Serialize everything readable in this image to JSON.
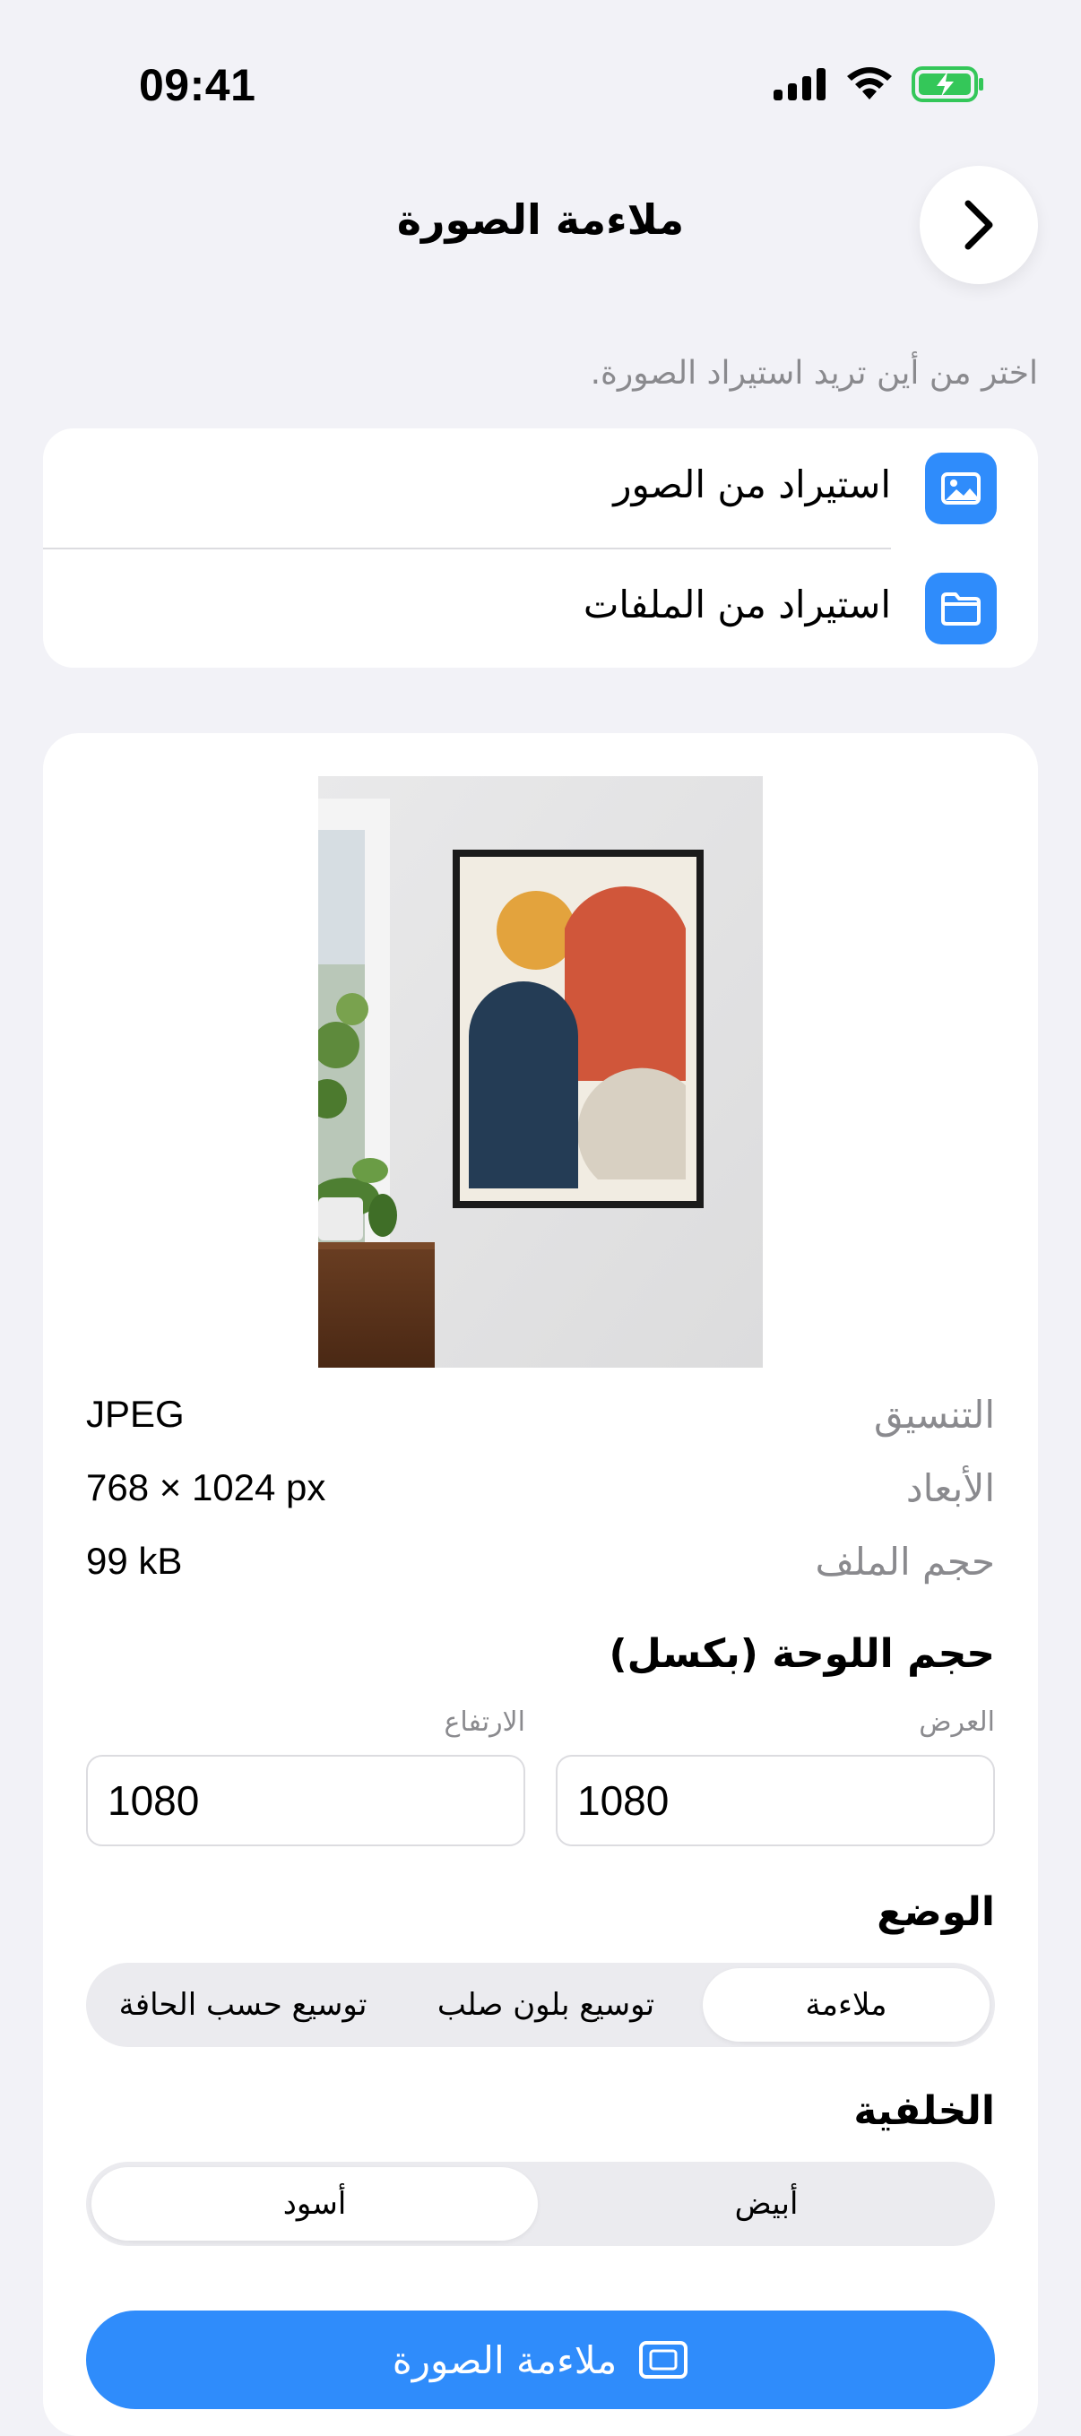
{
  "status_bar": {
    "time": "09:41"
  },
  "nav": {
    "title": "ملاءمة الصورة"
  },
  "hint": "اختر من أين تريد استيراد الصورة.",
  "import_options": [
    {
      "label": "استيراد من الصور",
      "icon": "photo-icon"
    },
    {
      "label": "استيراد من الملفات",
      "icon": "folder-icon"
    }
  ],
  "image_info": [
    {
      "key": "التنسيق",
      "value": "JPEG"
    },
    {
      "key": "الأبعاد",
      "value": "768 × 1024 px"
    },
    {
      "key": "حجم الملف",
      "value": "99 kB"
    }
  ],
  "canvas": {
    "title": "حجم اللوحة (بكسل)",
    "width_label": "العرض",
    "width_value": "1080",
    "height_label": "الارتفاع",
    "height_value": "1080"
  },
  "mode": {
    "title": "الوضع",
    "options": [
      "ملاءمة",
      "توسيع بلون صلب",
      "توسيع حسب الحافة"
    ],
    "selected": "ملاءمة"
  },
  "background": {
    "title": "الخلفية",
    "options": [
      "أبيض",
      "أسود"
    ],
    "selected": "أسود"
  },
  "primary_action": {
    "label": "ملاءمة الصورة"
  },
  "colors": {
    "accent": "#2F8CFB",
    "page_bg": "#F2F2F7",
    "battery": "#34C759"
  }
}
